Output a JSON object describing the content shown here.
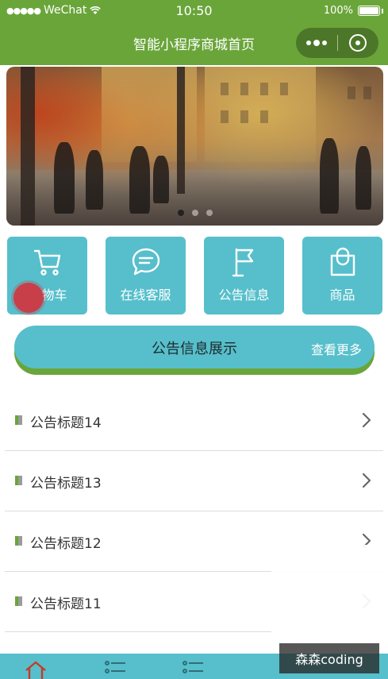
{
  "status_bar": {
    "carrier": "WeChat",
    "time": "10:50",
    "battery": "100%"
  },
  "nav": {
    "title": "智能小程序商城首页"
  },
  "banner": {
    "slide_count": 3,
    "active_index": 0
  },
  "menu": [
    {
      "label": "购物车",
      "visible_label": "物车",
      "icon": "cart-icon"
    },
    {
      "label": "在线客服",
      "icon": "chat-icon"
    },
    {
      "label": "公告信息",
      "icon": "flag-icon"
    },
    {
      "label": "商品",
      "icon": "bag-icon"
    }
  ],
  "notice": {
    "title": "公告信息展示",
    "more": "查看更多",
    "items": [
      {
        "title": "公告标题14"
      },
      {
        "title": "公告标题13"
      },
      {
        "title": "公告标题12"
      },
      {
        "title": "公告标题11"
      }
    ]
  },
  "watermark": "森森coding",
  "colors": {
    "primary_green": "#6aa53a",
    "accent_teal": "#56bfcb"
  }
}
